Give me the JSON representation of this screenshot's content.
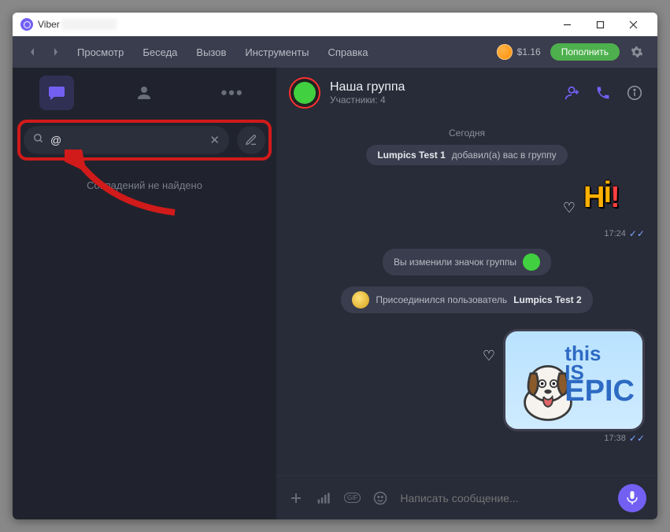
{
  "window": {
    "title_app": "Viber"
  },
  "menubar": {
    "view": "Просмотр",
    "conversation": "Беседа",
    "call": "Вызов",
    "tools": "Инструменты",
    "help": "Справка",
    "balance": "$1.16",
    "topup": "Пополнить"
  },
  "sidebar": {
    "search_value": "@",
    "no_results": "Совпадений не найдено"
  },
  "chat": {
    "title": "Наша группа",
    "subtitle": "Участники: 4",
    "date": "Сегодня",
    "sys1_pre": "Lumpics Test 1",
    "sys1_post": " добавил(а) вас в группу",
    "sys2": "Вы изменили значок группы",
    "sys3_pre": "Присоединился пользователь ",
    "sys3_post": "Lumpics Test 2",
    "time1": "17:24",
    "time2": "17:38",
    "input_placeholder": "Написать сообщение..."
  }
}
